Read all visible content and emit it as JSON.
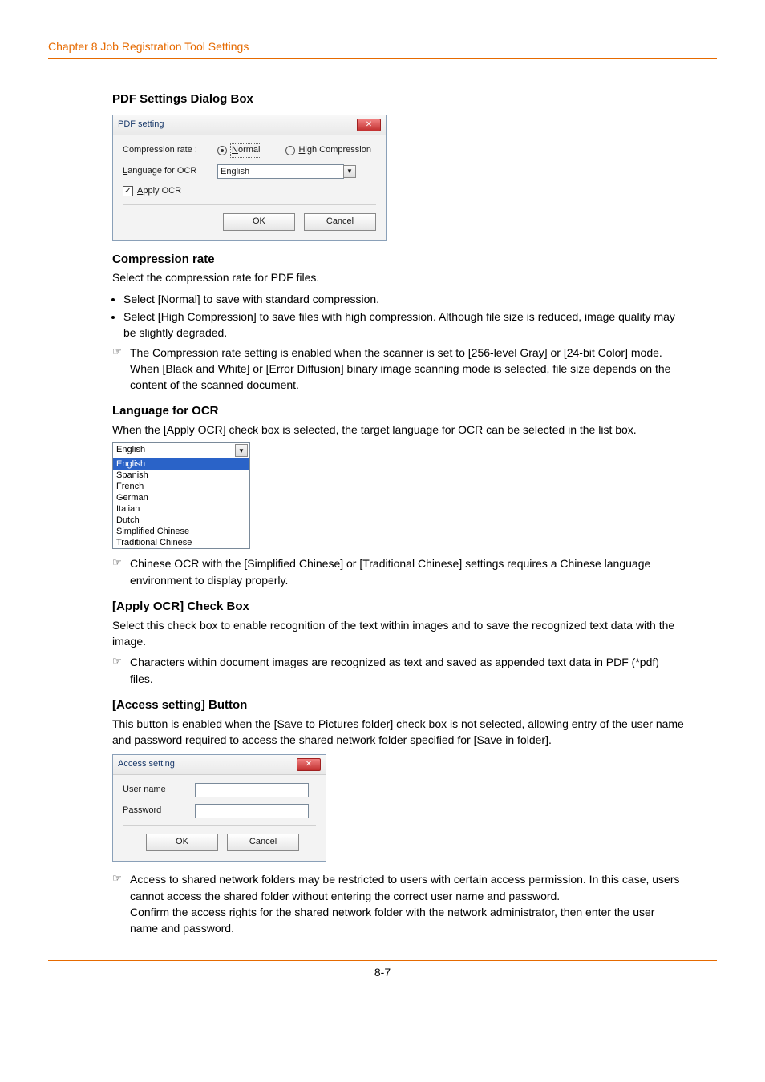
{
  "chapter": "Chapter 8   Job Registration Tool Settings",
  "page_number": "8-7",
  "section_title": "PDF Settings Dialog Box",
  "dlg_pdf": {
    "title": "PDF setting",
    "compression_label": "Compression rate :",
    "radio_normal_prefix": "N",
    "radio_normal_rest": "ormal",
    "radio_high_prefix": "H",
    "radio_high_rest": "igh Compression",
    "lang_label_prefix": "L",
    "lang_label_rest": "anguage for OCR",
    "lang_value": "English",
    "apply_prefix": "A",
    "apply_rest": "pply OCR",
    "ok": "OK",
    "cancel": "Cancel"
  },
  "h_comp": "Compression rate",
  "p_comp": "Select the compression rate for PDF files.",
  "b_comp_1": "Select [Normal] to save with standard compression.",
  "b_comp_2": "Select [High Compression] to save files with high compression. Although file size is reduced, image quality may be slightly degraded.",
  "n_comp": "The Compression rate setting is enabled when the scanner is set to [256-level Gray] or [24-bit Color] mode. When [Black and White] or [Error Diffusion] binary image scanning mode is selected, file size depends on the content of the scanned document.",
  "h_lang": "Language for OCR",
  "p_lang": "When the [Apply OCR] check box is selected, the target language for OCR can be selected in the list box.",
  "lang_list": {
    "selected": "English",
    "items": [
      "English",
      "Spanish",
      "French",
      "German",
      "Italian",
      "Dutch",
      "Simplified Chinese",
      "Traditional Chinese"
    ]
  },
  "n_lang": "Chinese OCR with the [Simplified Chinese] or [Traditional Chinese] settings requires a Chinese language environment to display properly.",
  "h_apply": "[Apply OCR] Check Box",
  "p_apply": "Select this check box to enable recognition of the text within images and to save the recognized text data with the image.",
  "n_apply": "Characters within document images are recognized as text and saved as appended text data in PDF (*pdf) files.",
  "h_access": "[Access setting] Button",
  "p_access": "This button is enabled when the [Save to Pictures folder] check box is not selected, allowing entry of the user name and password required to access the shared network folder specified for [Save in folder].",
  "dlg_access": {
    "title": "Access setting",
    "user": "User name",
    "pass": "Password",
    "ok": "OK",
    "cancel": "Cancel"
  },
  "n_access_1": "Access to shared network folders may be restricted to users with certain access permission. In this case, users cannot access the shared folder without entering the correct user name and password.",
  "n_access_2": "Confirm the access rights for the shared network folder with the network administrator, then enter the user name and password."
}
